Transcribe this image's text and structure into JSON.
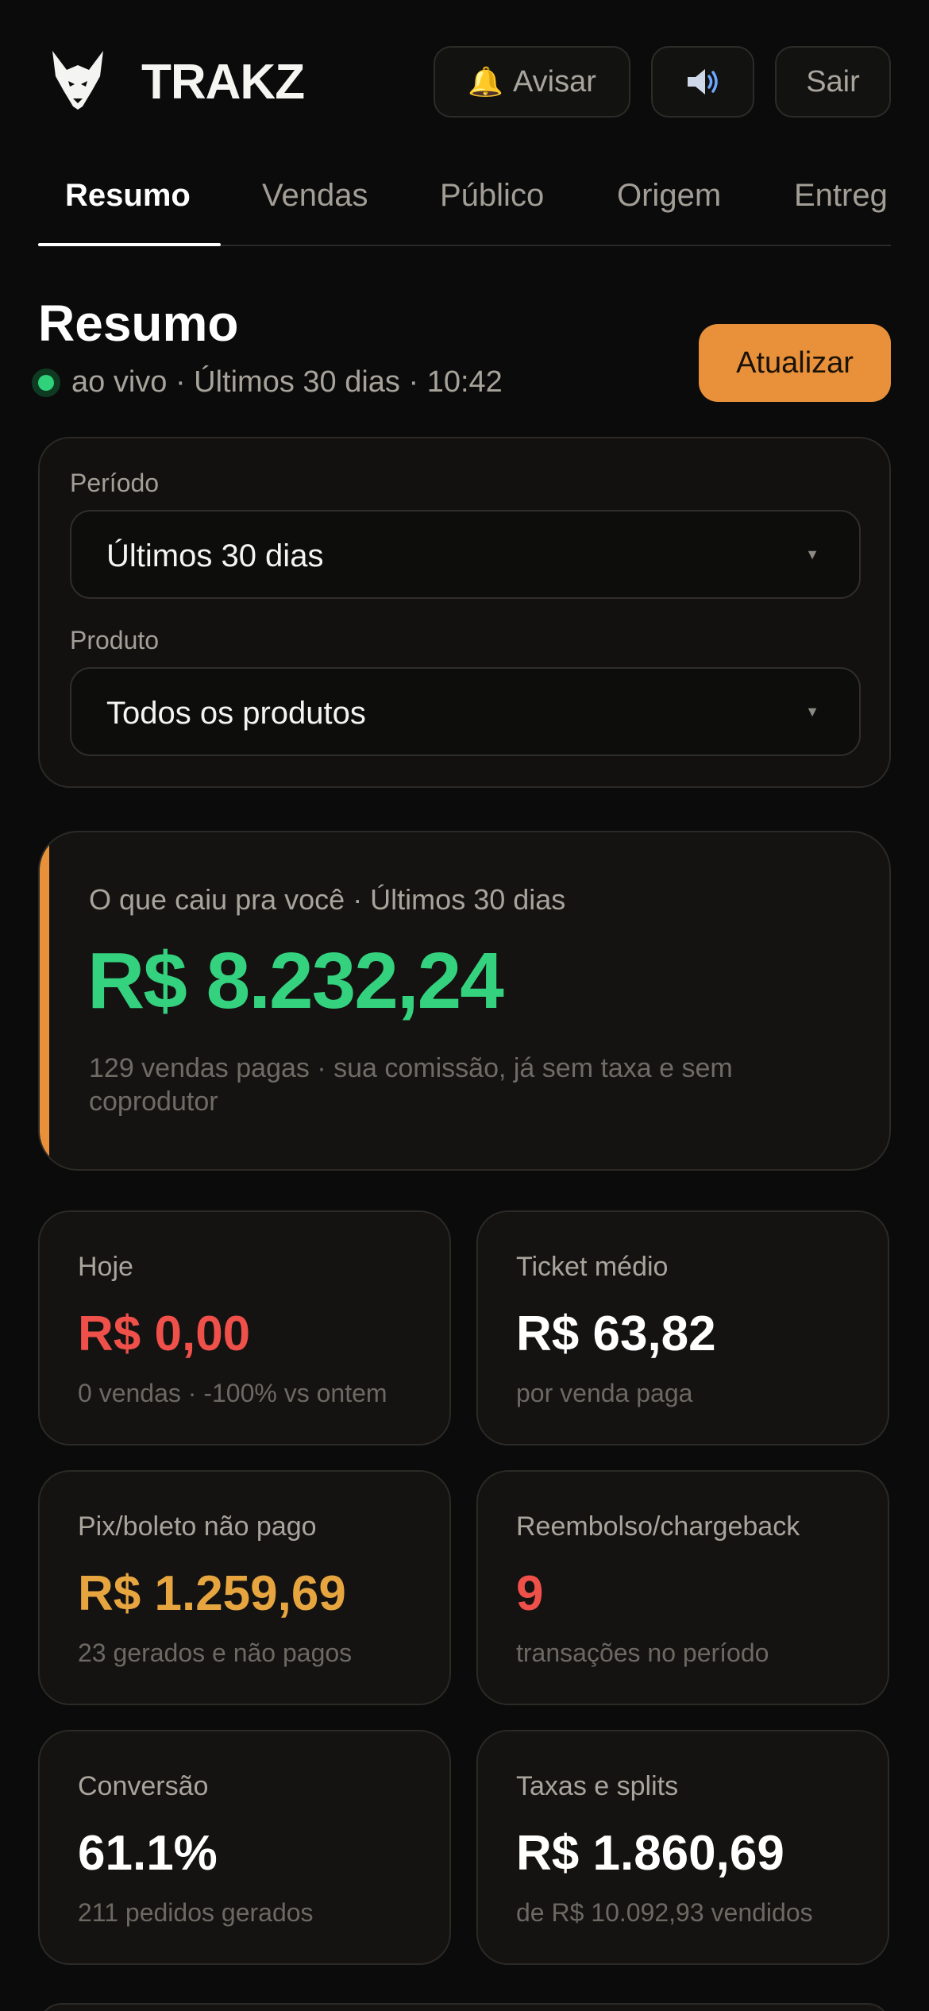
{
  "header": {
    "brand": "TRAKZ",
    "logo_icon": "fox-logo-icon",
    "notify_label": "Avisar",
    "notify_icon": "bell-icon",
    "sound_icon": "speaker-icon",
    "logout_label": "Sair"
  },
  "tabs": [
    {
      "label": "Resumo",
      "active": true
    },
    {
      "label": "Vendas",
      "active": false
    },
    {
      "label": "Público",
      "active": false
    },
    {
      "label": "Origem",
      "active": false
    },
    {
      "label": "Entreg",
      "active": false
    }
  ],
  "page": {
    "title": "Resumo",
    "status": "ao vivo · Últimos 30 dias · 10:42",
    "refresh_label": "Atualizar"
  },
  "filters": {
    "period_label": "Período",
    "period_value": "Últimos 30 dias",
    "product_label": "Produto",
    "product_value": "Todos os produtos"
  },
  "hero": {
    "label": "O que caiu pra você · Últimos 30 dias",
    "value": "R$ 8.232,24",
    "note": "129 vendas pagas · sua comissão, já sem taxa e sem coprodutor"
  },
  "cards": [
    {
      "label": "Hoje",
      "value": "R$ 0,00",
      "sub": "0 vendas · -100% vs ontem",
      "color": "#f0504a"
    },
    {
      "label": "Ticket médio",
      "value": "R$ 63,82",
      "sub": "por venda paga",
      "color": "#ffffff"
    },
    {
      "label": "Pix/boleto não pago",
      "value": "R$ 1.259,69",
      "sub": "23 gerados e não pagos",
      "color": "#e7a540"
    },
    {
      "label": "Reembolso/chargeback",
      "value": "9",
      "sub": "transações no período",
      "color": "#f0504a"
    },
    {
      "label": "Conversão",
      "value": "61.1%",
      "sub": "211 pedidos gerados",
      "color": "#ffffff"
    },
    {
      "label": "Taxas e splits",
      "value": "R$ 1.860,69",
      "sub": "de R$ 10.092,93 vendidos",
      "color": "#ffffff"
    }
  ],
  "colors": {
    "accent": "#e8913a",
    "positive": "#34d17e",
    "negative": "#f0504a",
    "warning": "#e7a540",
    "live": "#2fd27a"
  }
}
